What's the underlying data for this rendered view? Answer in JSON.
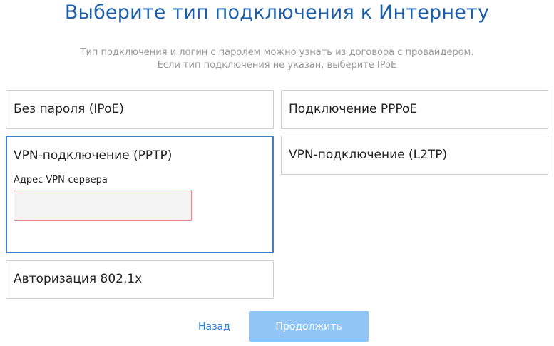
{
  "header": {
    "title": "Выберите тип подключения к Интернету",
    "subtitle_line1": "Тип подключения и логин с паролем можно узнать из договора с провайдером.",
    "subtitle_line2": "Если тип подключения не указан, выберите IPoE"
  },
  "options": [
    {
      "label": "Без пароля (IPoE)"
    },
    {
      "label": "Подключение PPPoE"
    },
    {
      "label": "VPN-подключение (PPTP)",
      "selected": true
    },
    {
      "label": "VPN-подключение (L2TP)"
    },
    {
      "label": "Авторизация 802.1x"
    }
  ],
  "vpn_server": {
    "label": "Адрес VPN-сервера",
    "value": "",
    "placeholder": ""
  },
  "footer": {
    "back_label": "Назад",
    "continue_label": "Продолжить"
  },
  "colors": {
    "accent": "#3d7fd0",
    "title": "#1d5fa8",
    "error_border": "#e48a8a",
    "button_disabled": "#90c5f5"
  }
}
